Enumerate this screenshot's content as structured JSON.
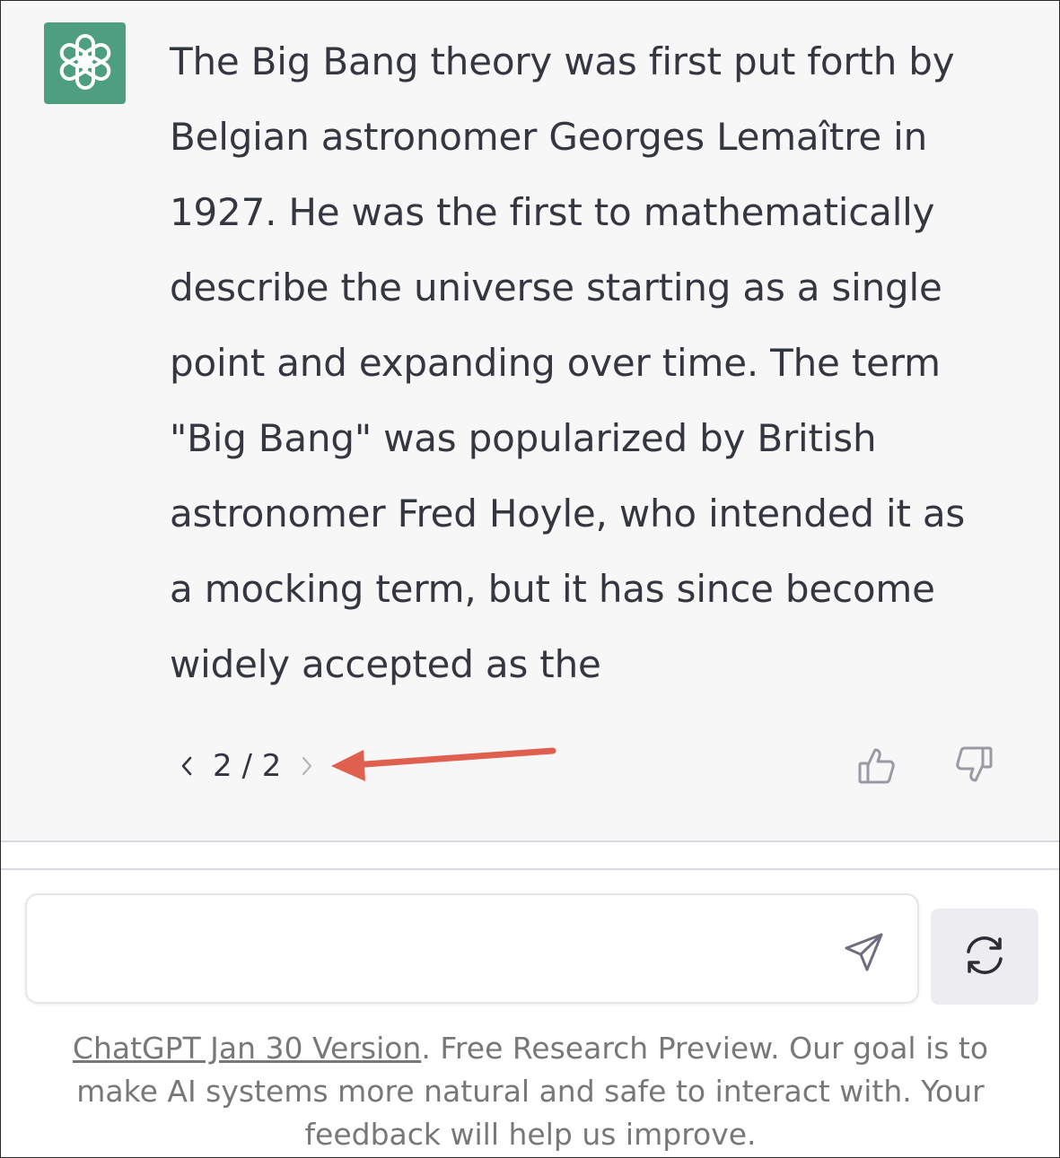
{
  "message": {
    "avatar_icon": "openai-logo-icon",
    "avatar_color": "#4e9f7f",
    "lines": [
      "The Big Bang theory was first put forth by",
      "Belgian astronomer Georges Lemaître in",
      "1927. He was the first to mathematically",
      "describe the universe starting as a single",
      "point and expanding over time. The term",
      "\"Big Bang\" was popularized by British",
      "astronomer Fred Hoyle, who intended it as",
      "a mocking term, but it has since become",
      "widely accepted as the"
    ]
  },
  "pager": {
    "count": "2 / 2",
    "prev_icon": "chevron-left-icon",
    "next_icon": "chevron-right-icon"
  },
  "annotation": {
    "arrow_color": "#e0604f"
  },
  "feedback": {
    "up_icon": "thumbs-up-icon",
    "down_icon": "thumbs-down-icon"
  },
  "composer": {
    "value": "",
    "placeholder": "",
    "send_icon": "send-icon",
    "regenerate_icon": "refresh-icon"
  },
  "footer": {
    "link_text": "ChatGPT Jan 30 Version",
    "rest_text": ". Free Research Preview. Our goal is to make AI systems more natural and safe to interact with. Your feedback will help us improve."
  }
}
